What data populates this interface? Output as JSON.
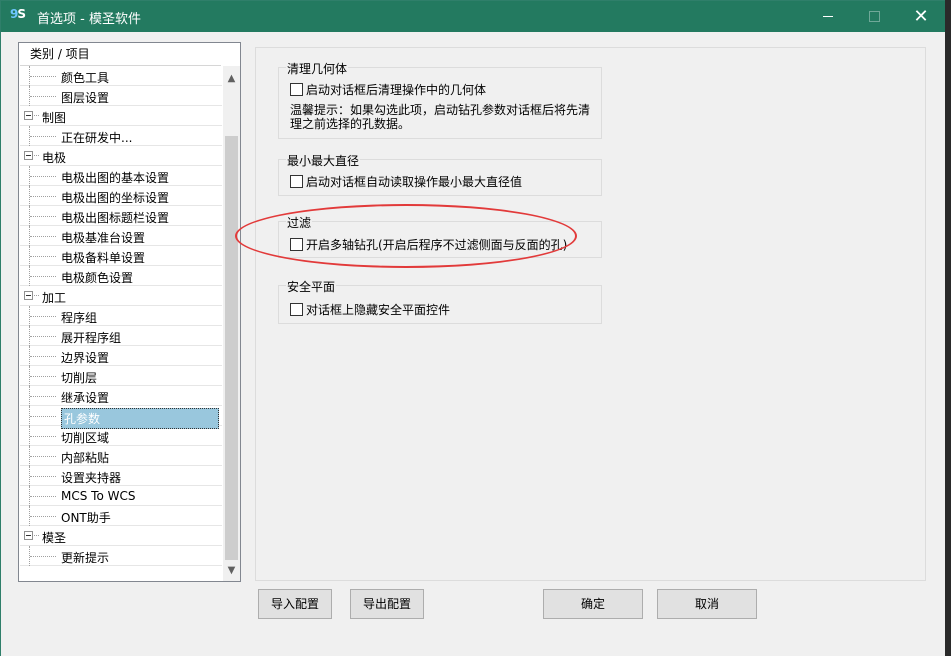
{
  "window": {
    "title": "首选项 - 模圣软件",
    "icon_text": "MS"
  },
  "tree": {
    "header": "类别 / 项目",
    "rows": [
      {
        "type": "child",
        "label": "颜色工具"
      },
      {
        "type": "child",
        "label": "图层设置"
      },
      {
        "type": "parent",
        "label": "制图"
      },
      {
        "type": "child",
        "label": "正在研发中..."
      },
      {
        "type": "parent",
        "label": "电极"
      },
      {
        "type": "child",
        "label": "电极出图的基本设置"
      },
      {
        "type": "child",
        "label": "电极出图的坐标设置"
      },
      {
        "type": "child",
        "label": "电极出图标题栏设置"
      },
      {
        "type": "child",
        "label": "电极基准台设置"
      },
      {
        "type": "child",
        "label": "电极备料单设置"
      },
      {
        "type": "child",
        "label": "电极颜色设置"
      },
      {
        "type": "parent",
        "label": "加工"
      },
      {
        "type": "child",
        "label": "程序组"
      },
      {
        "type": "child",
        "label": "展开程序组"
      },
      {
        "type": "child",
        "label": "边界设置"
      },
      {
        "type": "child",
        "label": "切削层"
      },
      {
        "type": "child",
        "label": "继承设置"
      },
      {
        "type": "child",
        "label": "孔参数",
        "selected": true
      },
      {
        "type": "child",
        "label": "切削区域"
      },
      {
        "type": "child",
        "label": "内部粘贴"
      },
      {
        "type": "child",
        "label": "设置夹持器"
      },
      {
        "type": "child",
        "label": "MCS To WCS"
      },
      {
        "type": "child",
        "label": "ONT助手"
      },
      {
        "type": "parent",
        "label": "模圣"
      },
      {
        "type": "child",
        "label": "更新提示"
      }
    ]
  },
  "groups": {
    "clean": {
      "title": "清理几何体",
      "checkbox": "启动对话框后清理操作中的几何体",
      "hint": "温馨提示：如果勾选此项，启动钻孔参数对话框后将先清理之前选择的孔数据。"
    },
    "diameter": {
      "title": "最小最大直径",
      "checkbox": "启动对话框自动读取操作最小最大直径值"
    },
    "filter": {
      "title": "过滤",
      "checkbox": "开启多轴钻孔(开启后程序不过滤侧面与反面的孔)"
    },
    "safety": {
      "title": "安全平面",
      "checkbox": "对话框上隐藏安全平面控件"
    }
  },
  "buttons": {
    "import": "导入配置",
    "export": "导出配置",
    "ok": "确定",
    "cancel": "取消"
  }
}
